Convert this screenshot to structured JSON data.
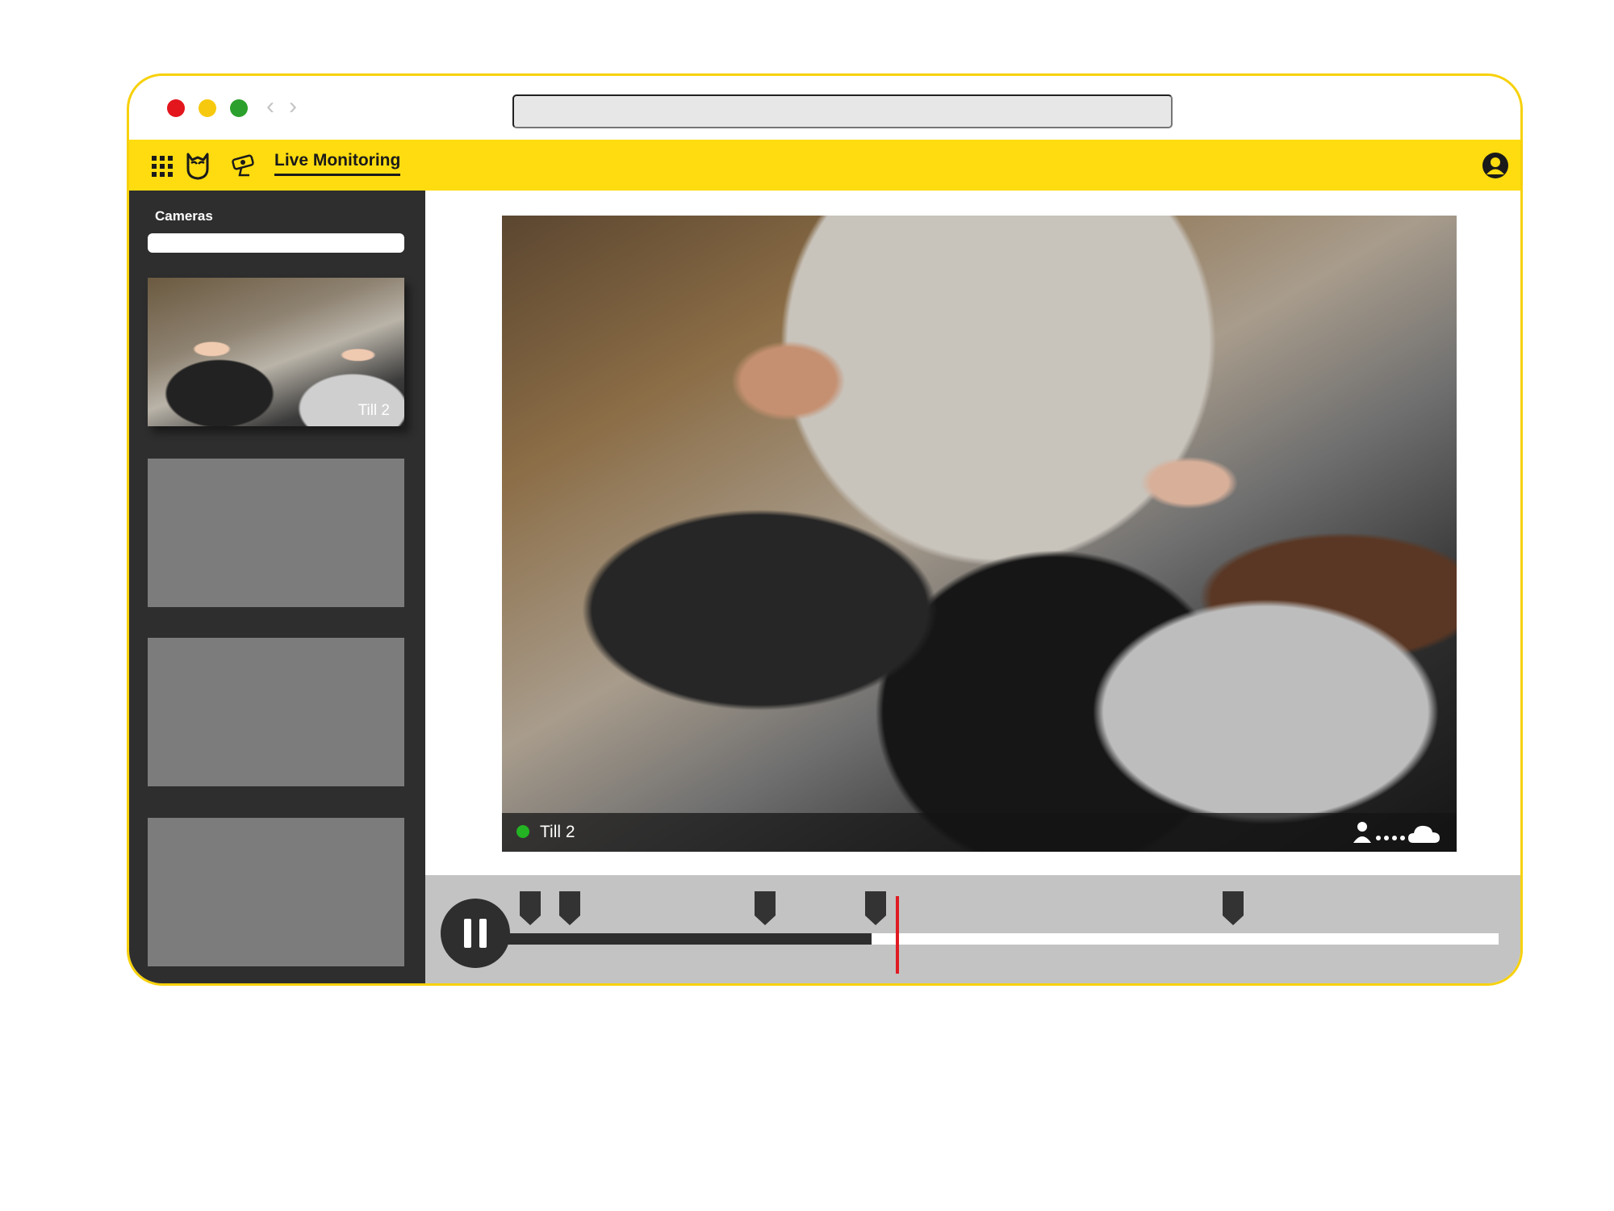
{
  "browser": {
    "address_value": "",
    "icons": {
      "back": "chevron-left-icon",
      "forward": "chevron-right-icon"
    },
    "window_controls": [
      "close",
      "minimize",
      "maximize"
    ]
  },
  "appbar": {
    "title": "Live Monitoring",
    "icons": [
      "apps-grid-icon",
      "owl-logo-icon",
      "security-camera-icon",
      "account-icon"
    ]
  },
  "sidebar": {
    "label": "Cameras",
    "search_value": "",
    "thumbnails": [
      {
        "label": "Till 2",
        "active": true
      },
      {
        "label": "",
        "active": false
      },
      {
        "label": "",
        "active": false
      },
      {
        "label": "",
        "active": false
      }
    ]
  },
  "video": {
    "camera_label": "Till 2",
    "status": "live",
    "status_icons": [
      "person-icon",
      "dots-icon",
      "cloud-icon"
    ]
  },
  "timeline": {
    "played_fraction": 0.369,
    "playhead_fraction": 0.395,
    "marker_fractions": [
      0.026,
      0.066,
      0.262,
      0.373,
      0.733
    ]
  },
  "colors": {
    "brand_yellow": "#fedc10",
    "frame_yellow": "#f7d10a",
    "sidebar_dark": "#2e2e2e",
    "playhead_red": "#e01b22",
    "live_green": "#23b323"
  }
}
